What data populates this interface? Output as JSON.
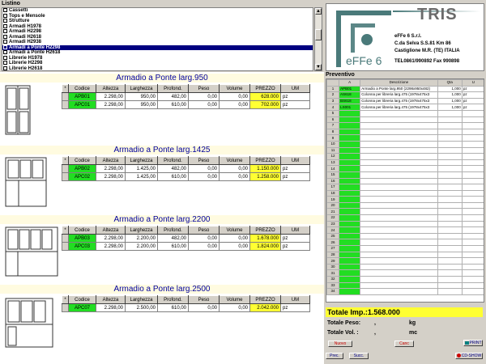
{
  "listino": {
    "label": "Listino",
    "items": [
      {
        "label": "Cassetti"
      },
      {
        "label": "Tops e Mensole"
      },
      {
        "label": "Strutture"
      },
      {
        "label": "Armadi H1978"
      },
      {
        "label": "Armadi H2298"
      },
      {
        "label": "Armadi H2618"
      },
      {
        "label": "Armadi H2938"
      },
      {
        "label": "Armadi a Ponte H2298",
        "selected": true
      },
      {
        "label": "Armadi a Ponte H2618"
      },
      {
        "label": "Librerie H1978"
      },
      {
        "label": "Librerie H2298"
      },
      {
        "label": "Librerie H2618"
      }
    ]
  },
  "logo": {
    "brand": "TRIS",
    "mark": "eFFe 6",
    "company": "eFFe 6  S.r.l.",
    "address1": "C.da Selva S.S.81 Km 86",
    "address2": "Castiglione M.R. (TE) ITALIA",
    "phone": "TEL0861/990892 Fax 990898"
  },
  "table_headers": {
    "codice": "Codice",
    "altezza": "Altezza",
    "larghezza": "Larghezza",
    "profond": "Profond.",
    "peso": "Peso",
    "volume": "Volume",
    "prezzo": "PREZZO",
    "um": "UM"
  },
  "sections": [
    {
      "title": "Armadio a Ponte larg.950",
      "rows": [
        {
          "codice": "APB01",
          "altezza": "2.298,00",
          "larghezza": "950,00",
          "profond": "482,00",
          "peso": "0,00",
          "volume": "0,00",
          "prezzo": "628.000",
          "um": "pz"
        },
        {
          "codice": "APC01",
          "altezza": "2.298,00",
          "larghezza": "950,00",
          "profond": "610,00",
          "peso": "0,00",
          "volume": "0,00",
          "prezzo": "702.000",
          "um": "pz"
        }
      ]
    },
    {
      "title": "Armadio a Ponte larg.1425",
      "rows": [
        {
          "codice": "APB02",
          "altezza": "2.298,00",
          "larghezza": "1.425,00",
          "profond": "482,00",
          "peso": "0,00",
          "volume": "0,00",
          "prezzo": "1.150.000",
          "um": "pz"
        },
        {
          "codice": "APC02",
          "altezza": "2.298,00",
          "larghezza": "1.425,00",
          "profond": "610,00",
          "peso": "0,00",
          "volume": "0,00",
          "prezzo": "1.258.000",
          "um": "pz"
        }
      ]
    },
    {
      "title": "Armadio a Ponte larg.2200",
      "rows": [
        {
          "codice": "APB03",
          "altezza": "2.298,00",
          "larghezza": "2.200,00",
          "profond": "482,00",
          "peso": "0,00",
          "volume": "0,00",
          "prezzo": "1.678.000",
          "um": "pz"
        },
        {
          "codice": "APC03",
          "altezza": "2.298,00",
          "larghezza": "2.200,00",
          "profond": "610,00",
          "peso": "0,00",
          "volume": "0,00",
          "prezzo": "1.824.000",
          "um": "pz"
        }
      ]
    },
    {
      "title": "Armadio a Ponte larg.2500",
      "rows": [
        {
          "codice": "APC07",
          "altezza": "2.298,00",
          "larghezza": "2.500,00",
          "profond": "610,00",
          "peso": "0,00",
          "volume": "0,00",
          "prezzo": "2.042.000",
          "um": "pz"
        }
      ]
    }
  ],
  "preventivo": {
    "label": "Preventivo",
    "headers": [
      "A",
      "Descrizione",
      "Qta",
      "U"
    ],
    "rows": [
      {
        "code": "APB01",
        "desc": "Armadio a Ponte larg.950 (2298x950x482)",
        "qta": "1,000",
        "um": "pz"
      },
      {
        "code": "AS618",
        "desc": "Colonna per libreria larg.475 (1978x475x3",
        "qta": "1,000",
        "um": "pz"
      },
      {
        "code": "BS618",
        "desc": "Colonna per libreria larg.475 (1978x475x3",
        "qta": "1,000",
        "um": "pz"
      },
      {
        "code": "LS001",
        "desc": "Colonna per libreria larg.475 (1978x475x3",
        "qta": "1,000",
        "um": "pz"
      }
    ],
    "row_count": 34
  },
  "totals": {
    "totale_imp": "Totale Imp.:1.568.000",
    "peso_label": "Totale Peso:",
    "peso_value": ",",
    "peso_unit": "kg",
    "vol_label": "Totale Vol. :",
    "vol_value": ",",
    "vol_unit": "mc"
  },
  "buttons": {
    "nuovo": "Nuovo",
    "canc": "Canc",
    "print": "PRINT",
    "prec": "Prec.",
    "succ": "Succ.",
    "cdshow": "CD-SHOW"
  }
}
